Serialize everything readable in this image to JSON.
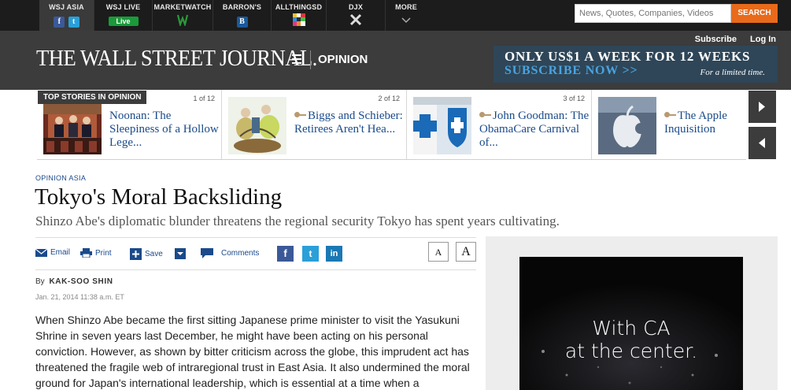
{
  "network": {
    "items": [
      {
        "label": "WSJ ASIA"
      },
      {
        "label": "WSJ LIVE",
        "badge": "Live"
      },
      {
        "label": "MARKETWATCH"
      },
      {
        "label": "BARRON'S",
        "badge": "B"
      },
      {
        "label": "ALLTHINGSD"
      },
      {
        "label": "DJX"
      },
      {
        "label": "MORE"
      }
    ],
    "search": {
      "placeholder": "News, Quotes, Companies, Videos",
      "button_label": "SEARCH"
    }
  },
  "masthead": {
    "logo": "THE WALL STREET JOURNAL.",
    "section": "OPINION",
    "subscribe_label": "Subscribe",
    "login_label": "Log In",
    "promo": {
      "line1": "ONLY US$1 A WEEK FOR 12 WEEKS",
      "line2": "SUBSCRIBE NOW >>",
      "line3": "For a limited time."
    }
  },
  "top_stories": {
    "tab_label": "TOP STORIES IN OPINION",
    "items": [
      {
        "count": "",
        "headline": "Noonan: The Sleepiness of a Hollow Lege...",
        "has_key": false
      },
      {
        "count": "2 of 12",
        "headline": "Biggs and Schieber: Retirees Aren't Hea...",
        "has_key": true
      },
      {
        "count": "3 of 12",
        "headline": "John Goodman: The ObamaCare Carnival of...",
        "has_key": true
      },
      {
        "count": "",
        "headline": "The Apple Inquisition",
        "has_key": true
      }
    ],
    "first_count": "1 of 12"
  },
  "article": {
    "kicker": "OPINION ASIA",
    "headline": "Tokyo's Moral Backsliding",
    "dek": "Shinzo Abe's diplomatic blunder threatens the regional security Tokyo has spent years cultivating.",
    "tools": {
      "email": "Email",
      "print": "Print",
      "save": "Save",
      "comments": "Comments"
    },
    "font_small": "A",
    "font_large": "A",
    "byline_prefix": "By",
    "author": "KAK-SOO SHIN",
    "date": "Jan. 21, 2014 11:38 a.m. ET",
    "body": "When Shinzo Abe became the first sitting Japanese prime minister to visit the Yasukuni Shrine in seven years last December, he might have been acting on his personal conviction. However, as shown by bitter criticism across the globe, this imprudent act has threatened the fragile web of intraregional trust in East Asia. It also undermined the moral ground for Japan's international leadership, which is essential at a time when a"
  },
  "ad": {
    "line1": "With CA",
    "line2": "at the center."
  },
  "colors": {
    "link": "#1a4a8a",
    "search_button": "#e86a1a",
    "promo_bg": "#2e4658",
    "promo_accent": "#4aa3df",
    "facebook": "#3b5998",
    "twitter": "#2a9fd8",
    "linkedin": "#1a78b4"
  }
}
